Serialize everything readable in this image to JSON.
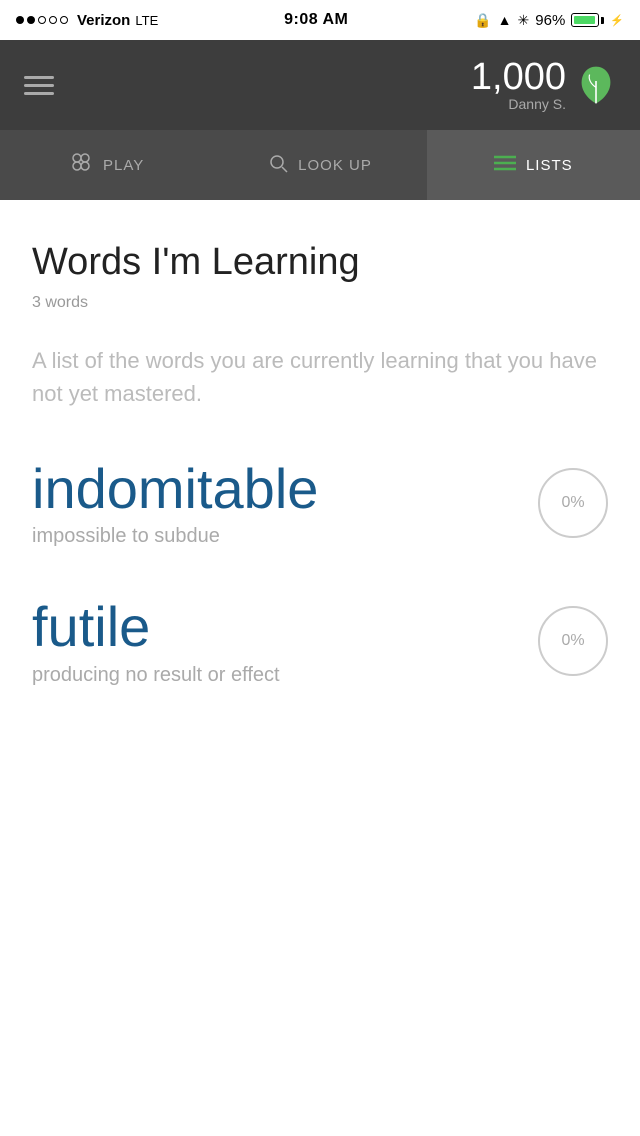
{
  "status_bar": {
    "carrier": "Verizon",
    "network": "LTE",
    "time": "9:08 AM",
    "battery": "96%",
    "signal_dots": [
      true,
      true,
      false,
      false,
      false
    ]
  },
  "header": {
    "score": "1,000",
    "username": "Danny S.",
    "leaf_color": "#5cb85c"
  },
  "nav": {
    "tabs": [
      {
        "id": "play",
        "label": "PLAY",
        "icon": "⊞",
        "active": false
      },
      {
        "id": "lookup",
        "label": "LOOK UP",
        "icon": "○",
        "active": false
      },
      {
        "id": "lists",
        "label": "LISTS",
        "icon": "≡",
        "active": true
      }
    ]
  },
  "list": {
    "title": "Words I'm Learning",
    "word_count": "3 words",
    "description": "A list of the words you are currently learning that you have not yet mastered.",
    "words": [
      {
        "id": "word-1",
        "text": "indomitable",
        "definition": "impossible to subdue",
        "progress": "0%"
      },
      {
        "id": "word-2",
        "text": "futile",
        "definition": "producing no result or effect",
        "progress": "0%"
      }
    ]
  }
}
